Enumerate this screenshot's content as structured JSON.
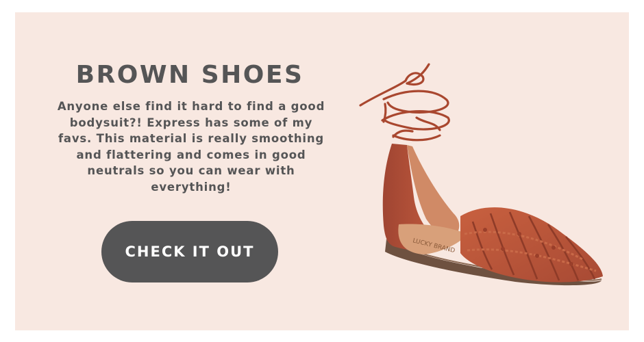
{
  "card": {
    "title": "BROWN SHOES",
    "description": "Anyone else find it hard to find a good bodysuit?! Express has some of my favs. This material is really smoothing and flattering and comes in good neutrals so you can wear with everything!",
    "cta_label": "CHECK IT OUT"
  },
  "product_image": {
    "icon": "sandal-image",
    "insole_brand_text": "LUCKY BRAND"
  },
  "colors": {
    "background": "#f8e8e1",
    "text": "#555556",
    "button": "#555556",
    "button_text": "#ffffff",
    "shoe": "#b9513a"
  }
}
